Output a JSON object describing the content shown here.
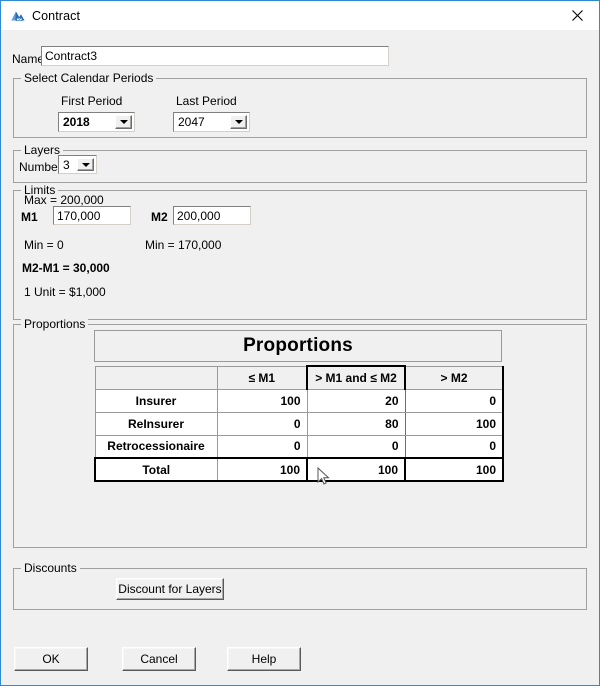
{
  "window": {
    "title": "Contract",
    "icon": "contract-app-icon",
    "close_label": "✕"
  },
  "name_field": {
    "label": "Name",
    "value": "Contract3",
    "placeholder": ""
  },
  "calendar_periods": {
    "group_title": "Select Calendar Periods",
    "first_period": {
      "label": "First Period",
      "value": "2018"
    },
    "last_period": {
      "label": "Last Period",
      "value": "2047"
    }
  },
  "layers": {
    "group_title": "Layers",
    "number_label": "Number",
    "number_value": "3"
  },
  "limits": {
    "group_title": "Limits",
    "max_text": "Max = 200,000",
    "m1_label": "M1",
    "m1_value": "170,000",
    "m2_label": "M2",
    "m2_value": "200,000",
    "m1_min_text": "Min = 0",
    "m2_min_text": "Min = 170,000",
    "difference_text": "M2-M1  =  30,000",
    "unit_text": "1 Unit = $1,000"
  },
  "proportions": {
    "group_title": "Proportions",
    "table_title": "Proportions",
    "columns": [
      "",
      "≤ M1",
      "> M1 and ≤ M2",
      "> M2"
    ],
    "rows": [
      {
        "label": "Insurer",
        "values": [
          "100",
          "20",
          "0"
        ]
      },
      {
        "label": "ReInsurer",
        "values": [
          "0",
          "80",
          "100"
        ]
      },
      {
        "label": "Retrocessionaire",
        "values": [
          "0",
          "0",
          "0"
        ]
      }
    ],
    "total_row": {
      "label": "Total",
      "values": [
        "100",
        "100",
        "100"
      ]
    }
  },
  "discounts": {
    "group_title": "Discounts",
    "button_label": "Discount for Layers"
  },
  "footer": {
    "ok_label": "OK",
    "cancel_label": "Cancel",
    "help_label": "Help"
  },
  "colors": {
    "window_border": "#2f8ad4",
    "dialog_face": "#f0f0f0",
    "field_bg": "#ffffff",
    "group_border": "#a0a0a0"
  }
}
